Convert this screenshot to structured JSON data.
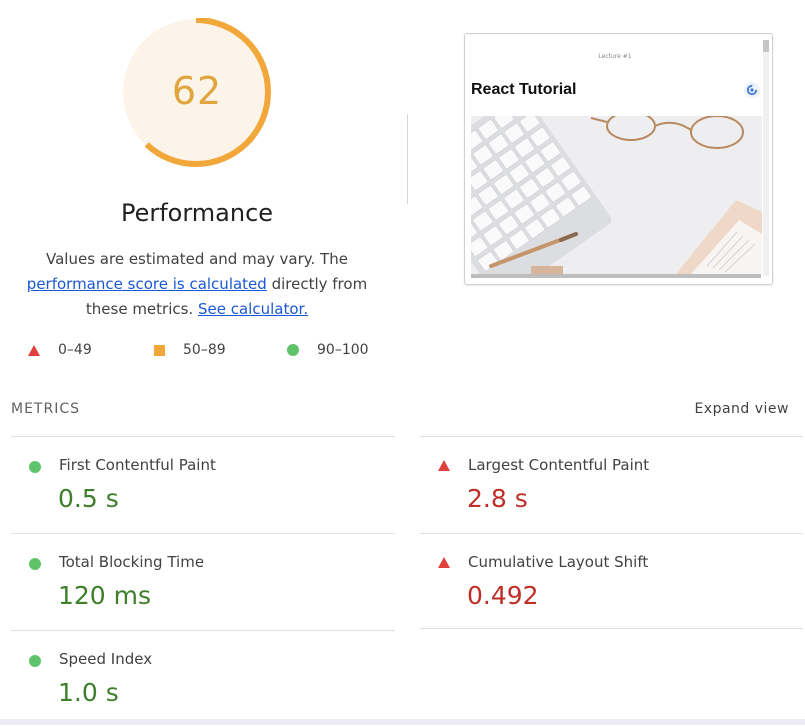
{
  "gauge": {
    "score": "62",
    "score_fraction": 0.62,
    "title": "Performance",
    "color": "#f2a73b"
  },
  "description": {
    "text_before": "Values are estimated and may vary. The ",
    "link_score": "performance score is calculated",
    "text_middle": " directly from these metrics.",
    "link_calculator": "See calculator."
  },
  "legend": [
    {
      "shape": "triangle",
      "label": "0–49",
      "color": "#e0413c"
    },
    {
      "shape": "square",
      "label": "50–89",
      "color": "#f2a73b"
    },
    {
      "shape": "circle",
      "label": "90–100",
      "color": "#5ec36b"
    }
  ],
  "screenshot": {
    "lecture_label": "Lecture #1",
    "title": "React Tutorial"
  },
  "metrics_header": {
    "title": "METRICS",
    "expand_label": "Expand view"
  },
  "metrics": [
    {
      "label": "First Contentful Paint",
      "value": "0.5 s",
      "status": "good"
    },
    {
      "label": "Largest Contentful Paint",
      "value": "2.8 s",
      "status": "bad"
    },
    {
      "label": "Total Blocking Time",
      "value": "120 ms",
      "status": "good"
    },
    {
      "label": "Cumulative Layout Shift",
      "value": "0.492",
      "status": "bad"
    },
    {
      "label": "Speed Index",
      "value": "1.0 s",
      "status": "good"
    }
  ],
  "colors": {
    "good_text": "#3e7f2b",
    "bad_text": "#bf2f28",
    "good_icon": "#5ec36b",
    "bad_icon": "#e0413c",
    "link": "#1a57d6"
  }
}
